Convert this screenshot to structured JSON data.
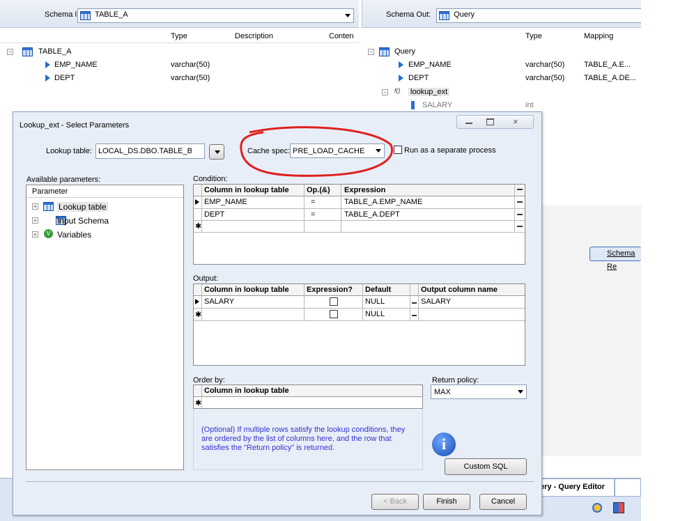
{
  "schema_in": {
    "label": "Schema In:",
    "value": "TABLE_A",
    "columns": [
      "Type",
      "Description",
      "Conten"
    ],
    "table": "TABLE_A",
    "rows": [
      {
        "name": "EMP_NAME",
        "type": "varchar(50)"
      },
      {
        "name": "DEPT",
        "type": "varchar(50)"
      }
    ]
  },
  "schema_out": {
    "label": "Schema Out:",
    "value": "Query",
    "columns": [
      "Type",
      "Mapping"
    ],
    "table": "Query",
    "rows": [
      {
        "name": "EMP_NAME",
        "type": "varchar(50)",
        "mapping": "TABLE_A.E..."
      },
      {
        "name": "DEPT",
        "type": "varchar(50)",
        "mapping": "TABLE_A.DE..."
      }
    ],
    "func_prefix": "f()",
    "func": "lookup_ext",
    "func_rows": [
      {
        "name": "SALARY",
        "type": "int"
      }
    ]
  },
  "bg": {
    "schema_button": "Schema Re",
    "tab_label": "ery - Query Editor"
  },
  "dialog": {
    "title": "Lookup_ext - Select Parameters",
    "lookup_table_label": "Lookup table:",
    "lookup_table_value": "LOCAL_DS.DBO.TABLE_B",
    "cache_spec_label": "Cache spec:",
    "cache_spec_value": "PRE_LOAD_CACHE",
    "run_separate_label": "Run as a separate process",
    "available_label": "Available parameters:",
    "param_header": "Parameter",
    "params": [
      "Lookup table",
      "Input Schema",
      "Variables"
    ],
    "condition": {
      "label": "Condition:",
      "headers": [
        "Column in lookup table",
        "Op.(&)",
        "Expression"
      ],
      "rows": [
        {
          "col": "EMP_NAME",
          "op": "=",
          "expr": "TABLE_A.EMP_NAME"
        },
        {
          "col": "DEPT",
          "op": "=",
          "expr": "TABLE_A.DEPT"
        }
      ]
    },
    "output": {
      "label": "Output:",
      "headers": [
        "Column in lookup table",
        "Expression?",
        "Default",
        "Output column name"
      ],
      "rows": [
        {
          "col": "SALARY",
          "default": "NULL",
          "out": "SALARY"
        },
        {
          "col": "",
          "default": "NULL",
          "out": ""
        }
      ]
    },
    "order_by": {
      "label": "Order by:",
      "header": "Column in lookup table"
    },
    "return_policy": {
      "label": "Return policy:",
      "value": "MAX"
    },
    "info_text": "(Optional) If multiple rows satisfy the lookup conditions, they are ordered by the list of columns here, and the row that satisfies the \"Return policy\" is returned.",
    "buttons": {
      "custom_sql": "Custom SQL",
      "back": "< Back",
      "finish": "Finish",
      "cancel": "Cancel"
    }
  },
  "colors": {
    "highlight": "#e02020",
    "info_text": "#3333cc",
    "window_bg": "#e8eef7"
  }
}
